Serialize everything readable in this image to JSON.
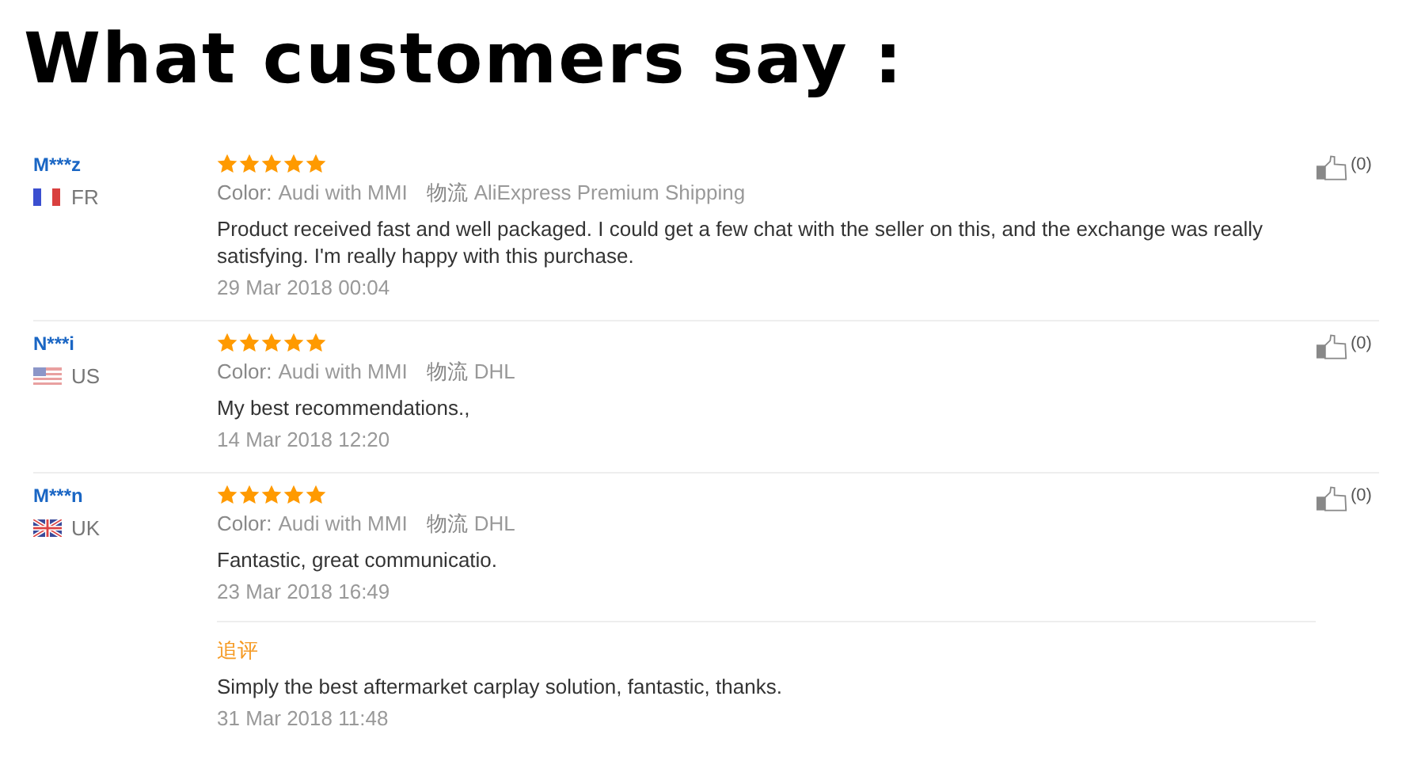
{
  "heading": "What customers say :",
  "reviews": [
    {
      "user": "M***z",
      "flag": {
        "kind": "france"
      },
      "country": "FR",
      "stars": 5,
      "meta": [
        {
          "label": "Color:",
          "value": "Audi with MMI"
        },
        {
          "label": "物流",
          "value": "AliExpress Premium Shipping"
        }
      ],
      "text": "Product received fast and well packaged. I could get a few chat with the seller on this, and the exchange was really satisfying. I'm really happy with this purchase.",
      "date": "29 Mar 2018 00:04",
      "helpful": "(0)"
    },
    {
      "user": "N***i",
      "flag": {
        "kind": "usa"
      },
      "country": "US",
      "stars": 5,
      "meta": [
        {
          "label": "Color:",
          "value": "Audi with MMI"
        },
        {
          "label": "物流",
          "value": "DHL"
        }
      ],
      "text": "My best recommendations.,",
      "date": "14 Mar 2018 12:20",
      "helpful": "(0)"
    },
    {
      "user": "M***n",
      "flag": {
        "kind": "uk"
      },
      "country": "UK",
      "stars": 5,
      "meta": [
        {
          "label": "Color:",
          "value": "Audi with MMI"
        },
        {
          "label": "物流",
          "value": "DHL"
        }
      ],
      "text": "Fantastic, great communicatio.",
      "date": "23 Mar 2018 16:49",
      "helpful": "(0)",
      "followup": {
        "label": "追评",
        "text": "Simply the best aftermarket carplay solution, fantastic, thanks.",
        "date": "31 Mar 2018 11:48"
      }
    }
  ]
}
